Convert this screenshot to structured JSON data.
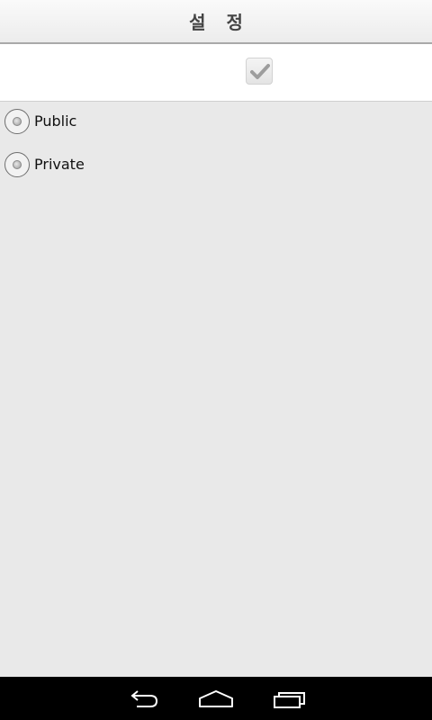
{
  "header": {
    "title": "설 정"
  },
  "settings": {
    "checkbox_checked": true
  },
  "radio_options": [
    {
      "label": "Public",
      "selected": false
    },
    {
      "label": "Private",
      "selected": false
    }
  ],
  "nav_bar": {
    "icons": [
      "back-icon",
      "home-icon",
      "recent-apps-icon"
    ]
  },
  "colors": {
    "background": "#e9e9e9",
    "nav_bar": "#000000",
    "title_text": "#444444"
  }
}
